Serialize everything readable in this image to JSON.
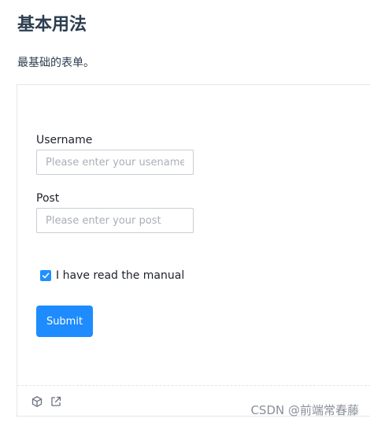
{
  "header": {
    "title": "基本用法",
    "description": "最基础的表单。"
  },
  "form": {
    "username": {
      "label": "Username",
      "placeholder": "Please enter your usename",
      "value": ""
    },
    "post": {
      "label": "Post",
      "placeholder": "Please enter your post",
      "value": ""
    },
    "manual_checkbox": {
      "label": "I have read the manual",
      "checked": true
    },
    "submit_label": "Submit"
  },
  "footer": {
    "icons": [
      "cube-icon",
      "external-link-icon"
    ]
  },
  "watermark": "CSDN @前端常春藤",
  "colors": {
    "accent": "#1e8cff",
    "title": "#2c3e50",
    "border": "#e5e6eb"
  }
}
